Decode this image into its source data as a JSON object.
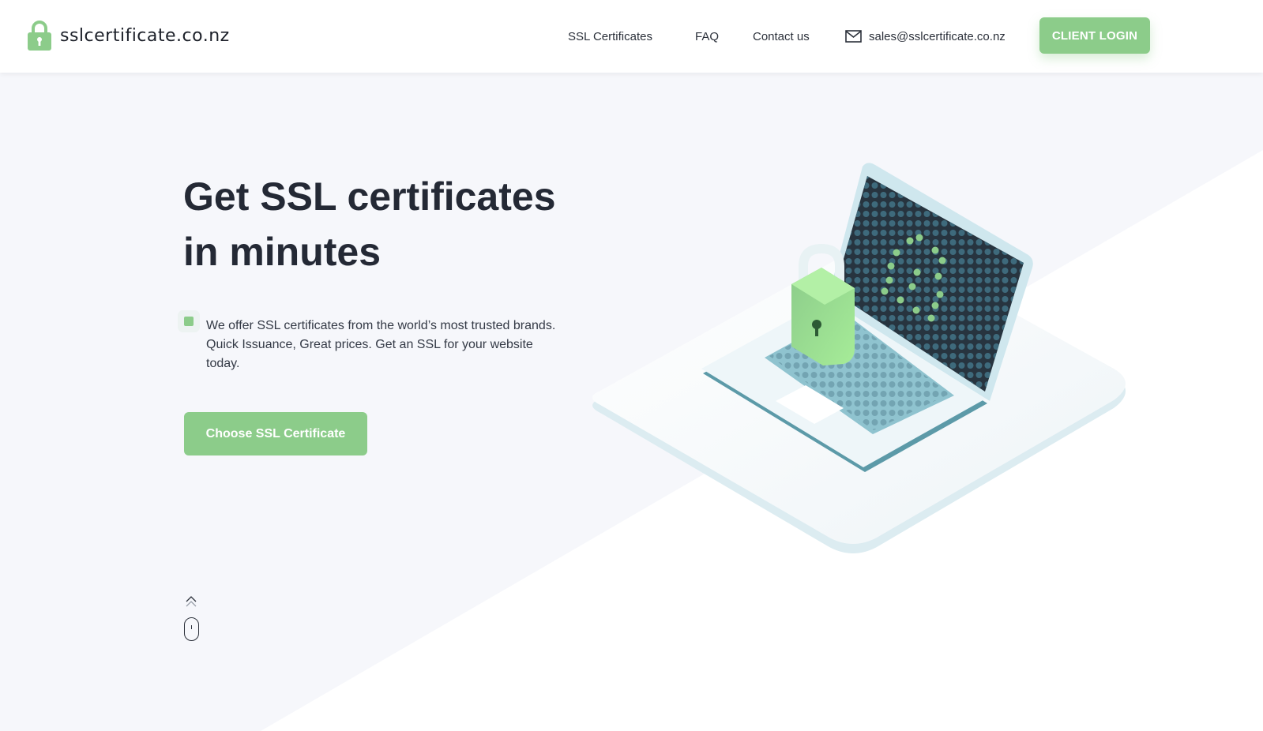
{
  "header": {
    "logo_text": "sslcertificate.co.nz",
    "nav": {
      "ssl_certificates": "SSL Certificates",
      "faq": "FAQ",
      "contact": "Contact us",
      "email": "sales@sslcertificate.co.nz"
    },
    "login_label": "CLIENT LOGIN"
  },
  "hero": {
    "title_line1": "Get SSL certificates",
    "title_line2": "in minutes",
    "description": "We offer SSL certificates from the world’s most trusted brands. Quick Issuance, Great prices. Get an SSL for your website today.",
    "cta_label": "Choose SSL Certificate"
  },
  "icons": {
    "logo": "padlock-icon",
    "email": "envelope-icon",
    "scroll_up": "chevron-up-icon",
    "scroll": "mouse-scroll-icon"
  },
  "colors": {
    "accent": "#8ccc8a",
    "text": "#242935",
    "background": "#f6f7fb"
  }
}
